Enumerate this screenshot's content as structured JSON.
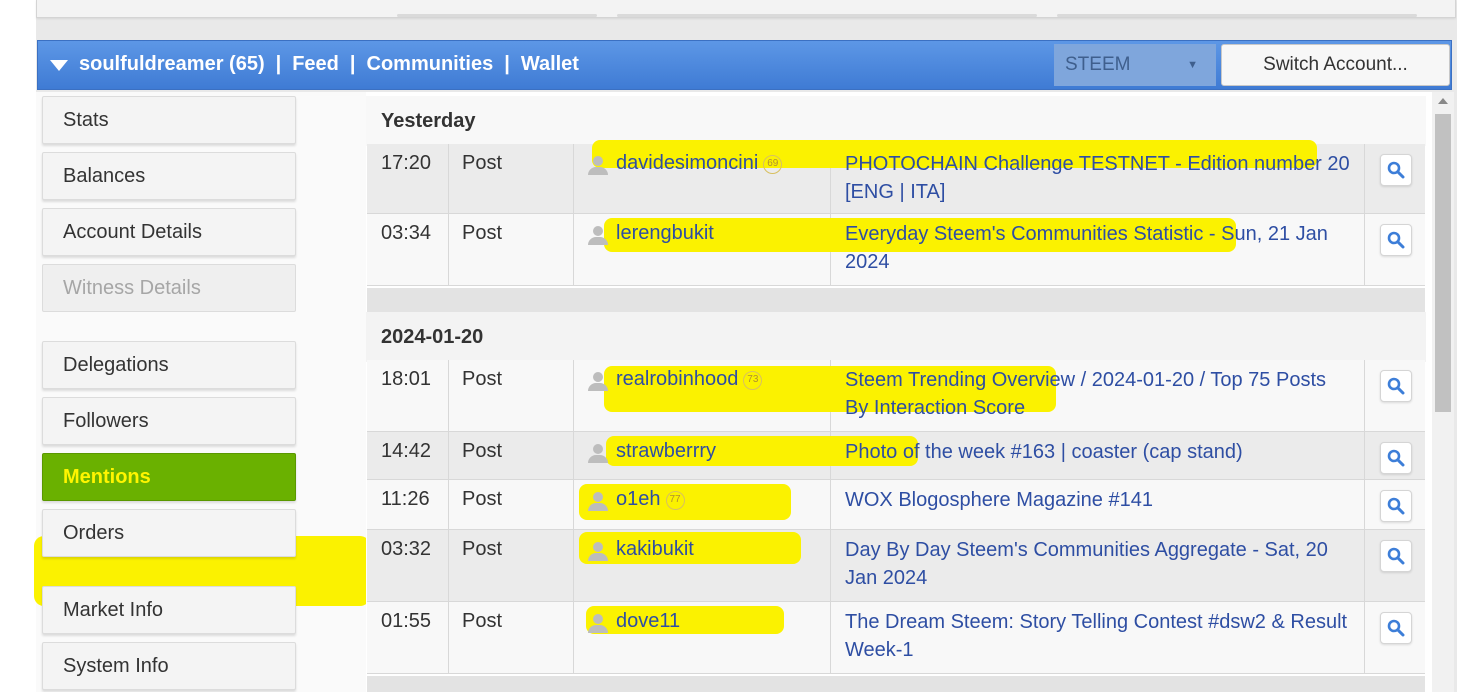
{
  "topbar": {
    "account": "soulfuldreamer (65)",
    "links": [
      "Feed",
      "Communities",
      "Wallet"
    ],
    "separator": "|",
    "currency": "STEEM",
    "switch_label": "Switch Account...",
    "color": "#4a88e0"
  },
  "sidebar": {
    "items": [
      {
        "label": "Stats",
        "state": "normal"
      },
      {
        "label": "Balances",
        "state": "normal"
      },
      {
        "label": "Account Details",
        "state": "normal"
      },
      {
        "label": "Witness Details",
        "state": "disabled"
      },
      {
        "label": "Delegations",
        "state": "normal"
      },
      {
        "label": "Followers",
        "state": "normal"
      },
      {
        "label": "Mentions",
        "state": "active"
      },
      {
        "label": "Orders",
        "state": "normal"
      },
      {
        "label": "Market Info",
        "state": "normal"
      },
      {
        "label": "System Info",
        "state": "normal"
      }
    ],
    "active_color": "#6ab100"
  },
  "mentions": {
    "groups": [
      {
        "date": "Yesterday",
        "rows": [
          {
            "time": "17:20",
            "type": "Post",
            "user": "davidesimoncini",
            "rep": "69",
            "title": "PHOTOCHAIN Challenge TESTNET - Edition number 20 [ENG | ITA]"
          },
          {
            "time": "03:34",
            "type": "Post",
            "user": "lerengbukit",
            "rep": "",
            "title": "Everyday Steem's Communities Statistic - Sun, 21 Jan 2024"
          }
        ]
      },
      {
        "date": "2024-01-20",
        "rows": [
          {
            "time": "18:01",
            "type": "Post",
            "user": "realrobinhood",
            "rep": "73",
            "title": "Steem Trending Overview / 2024-01-20 / Top 75 Posts By Interaction Score"
          },
          {
            "time": "14:42",
            "type": "Post",
            "user": "strawberrry",
            "rep": "",
            "title": "Photo of the week #163 | coaster (cap stand)"
          },
          {
            "time": "11:26",
            "type": "Post",
            "user": "o1eh",
            "rep": "77",
            "title": "WOX Blogosphere Magazine #141"
          },
          {
            "time": "03:32",
            "type": "Post",
            "user": "kakibukit",
            "rep": "",
            "title": "Day By Day Steem's Communities Aggregate - Sat, 20 Jan 2024"
          },
          {
            "time": "01:55",
            "type": "Post",
            "user": "dove11",
            "rep": "",
            "title": "The Dream Steem: Story Telling Contest #dsw2 & Result Week-1"
          }
        ]
      }
    ],
    "highlight_color": "#fbf200",
    "link_color": "#2e4ea3"
  }
}
